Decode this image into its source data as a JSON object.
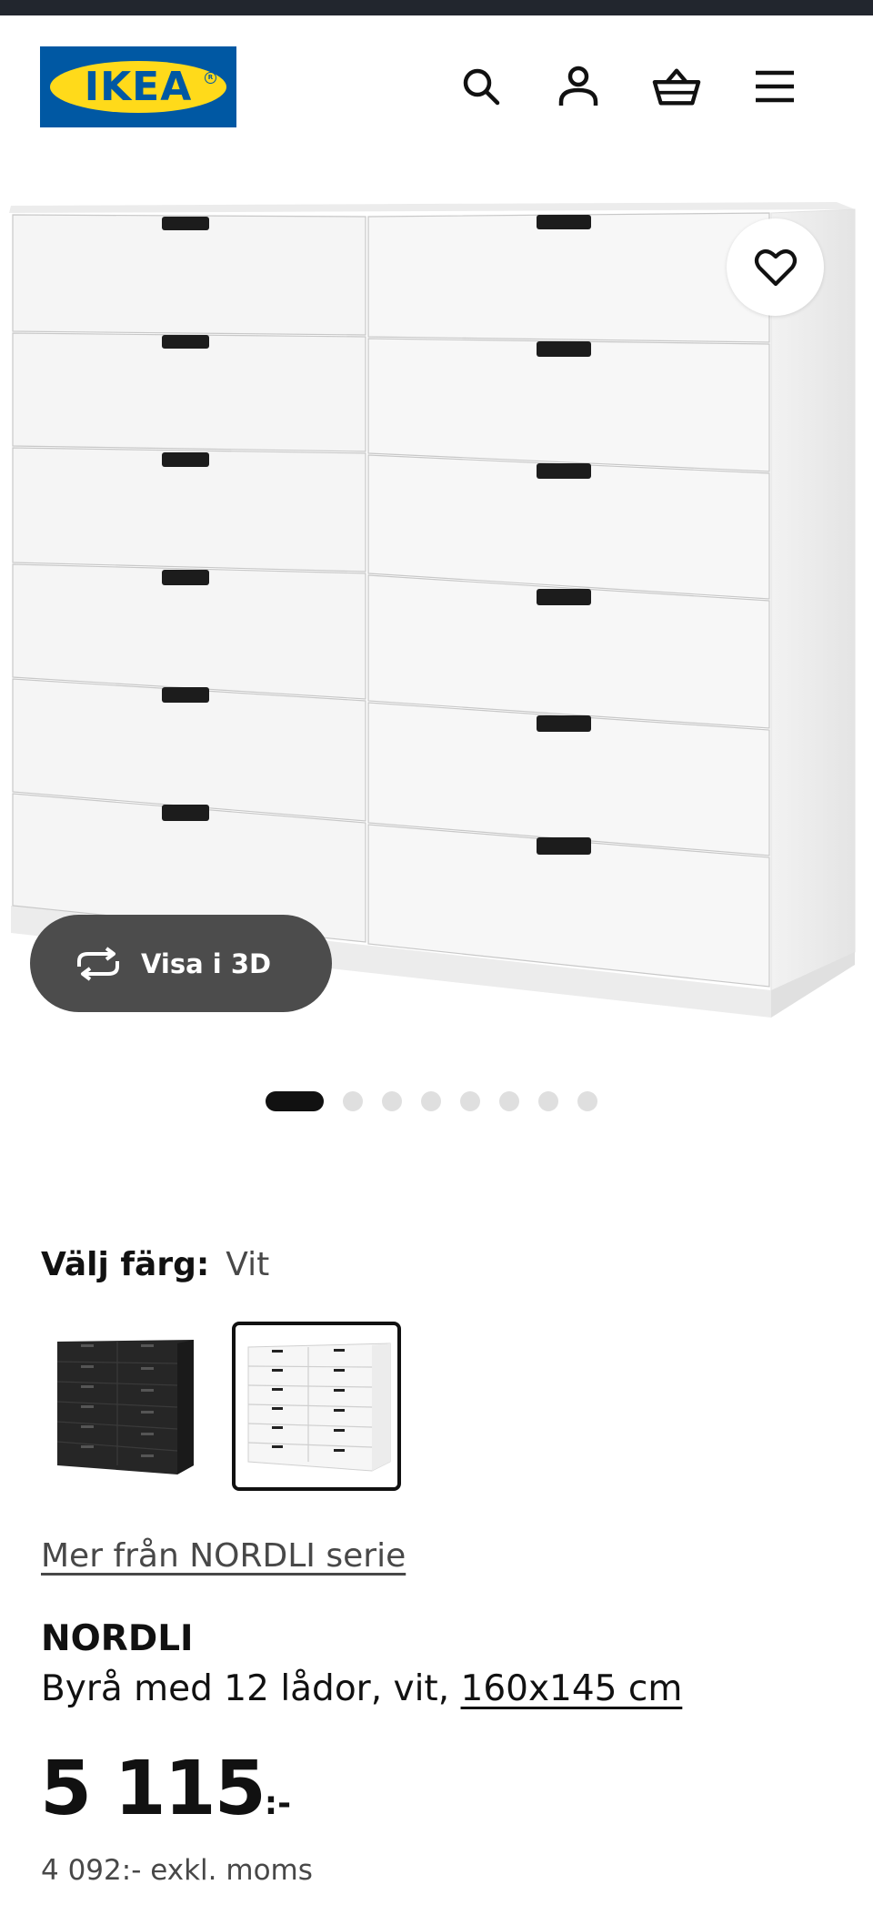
{
  "header": {
    "brand": "IKEA",
    "icons": [
      "search-icon",
      "profile-icon",
      "shopping-bag-icon",
      "menu-icon"
    ]
  },
  "gallery": {
    "favorite_icon": "heart-icon",
    "view_3d_icon": "rotate-3d-icon",
    "view_3d_label": "Visa i 3D",
    "slide_count": 8,
    "active_slide": 1
  },
  "color_selection": {
    "label": "Välj färg:",
    "selected_value": "Vit",
    "options": [
      {
        "name": "black",
        "color": "#1f1f1f",
        "selected": false
      },
      {
        "name": "white",
        "color": "#ffffff",
        "selected": true
      }
    ]
  },
  "product": {
    "series_link": "Mer från NORDLI serie",
    "name": "NORDLI",
    "description": "Byrå med 12 lådor, vit, ",
    "dimensions": "160x145 cm",
    "price_integer": "5 115",
    "price_suffix": ":-",
    "price_excl_vat": "4 092:- exkl. moms"
  },
  "colors": {
    "text": "#111111",
    "muted": "#484848",
    "ikea_blue": "#0058a3",
    "ikea_yellow": "#ffda1a",
    "button_dark": "#4c4c4c",
    "dot_inactive": "#dfdfdf"
  }
}
